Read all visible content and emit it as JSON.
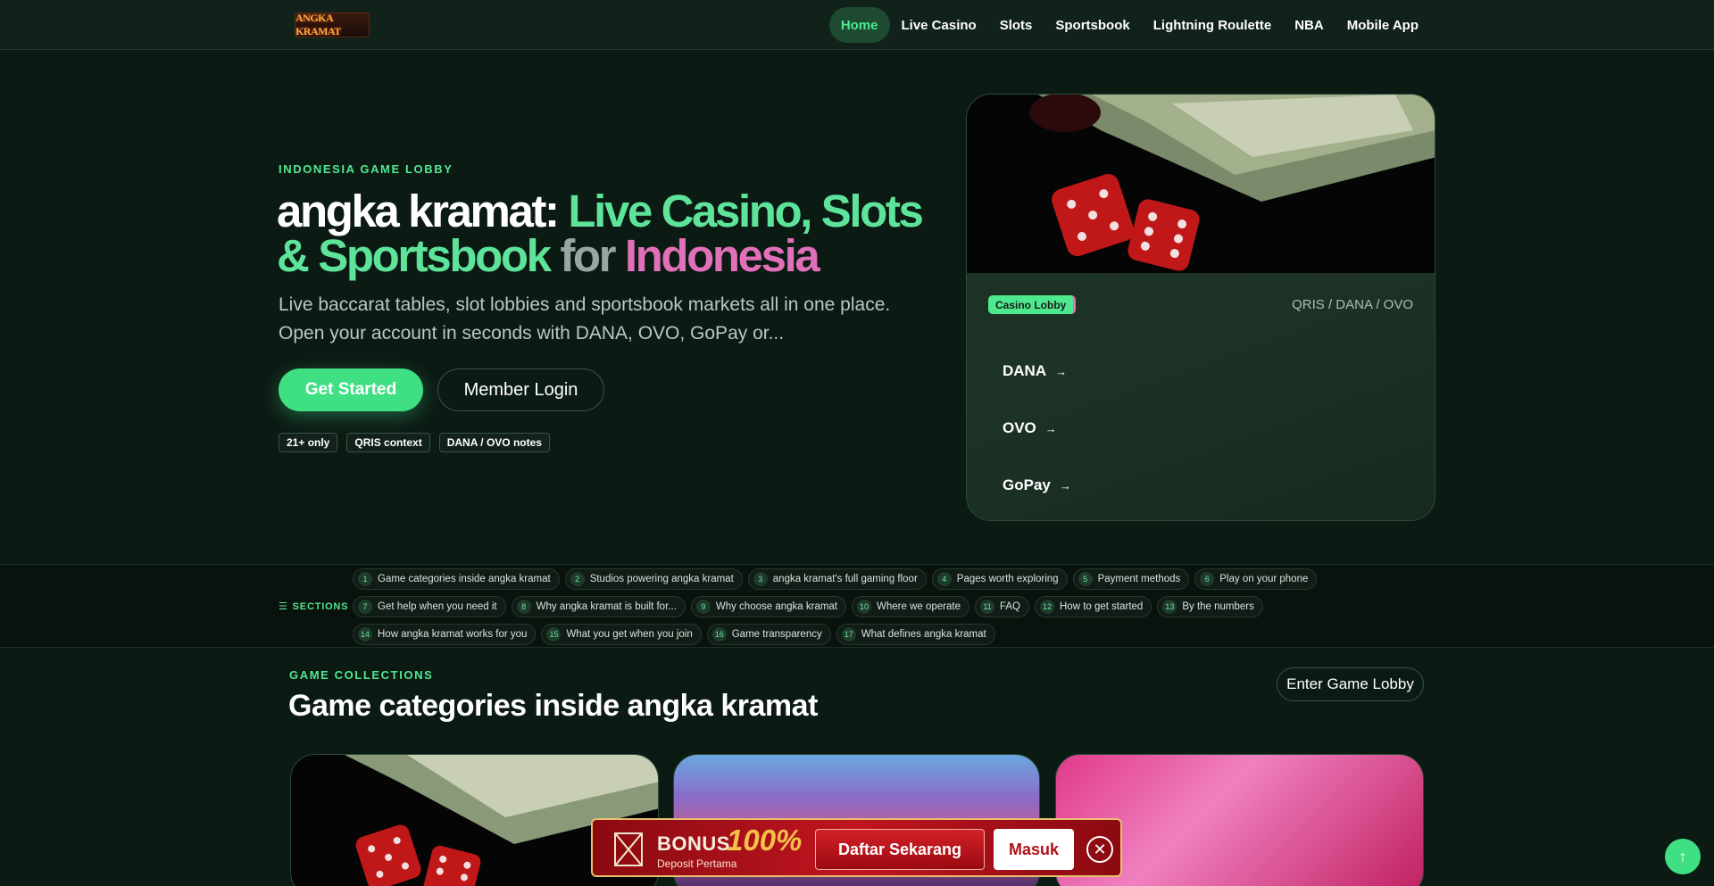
{
  "brand": {
    "logo_text": "ANGKA KRAMAT"
  },
  "nav": {
    "items": [
      {
        "label": "Home",
        "active": true
      },
      {
        "label": "Live Casino"
      },
      {
        "label": "Slots"
      },
      {
        "label": "Sportsbook"
      },
      {
        "label": "Lightning Roulette"
      },
      {
        "label": "NBA"
      },
      {
        "label": "Mobile App"
      }
    ]
  },
  "hero": {
    "eyebrow": "INDONESIA GAME LOBBY",
    "title_part1": "angka kramat: ",
    "title_part2": "Live Casino, Slots & Sportsbook",
    "title_part3": " for ",
    "title_part4": "Indonesia",
    "subtitle": "Live baccarat tables, slot lobbies and sportsbook markets all in one place. Open your account in seconds with DANA, OVO, GoPay or...",
    "primary_button": "Get Started",
    "secondary_button": "Member Login",
    "chips": [
      "21+ only",
      "QRIS context",
      "DANA / OVO notes"
    ]
  },
  "card": {
    "badge": "Casino Lobby",
    "payment_note": "QRIS / DANA / OVO",
    "payments": [
      "DANA",
      "OVO",
      "GoPay"
    ]
  },
  "sections": {
    "label": "SECTIONS",
    "items": [
      "Game categories inside angka kramat",
      "Studios powering angka kramat",
      "angka kramat's full gaming floor",
      "Pages worth exploring",
      "Payment methods",
      "Play on your phone",
      "Get help when you need it",
      "Why angka kramat is built for...",
      "Why choose angka kramat",
      "Where we operate",
      "FAQ",
      "How to get started",
      "By the numbers",
      "How angka kramat works for you",
      "What you get when you join",
      "Game transparency",
      "What defines angka kramat"
    ]
  },
  "collections": {
    "eyebrow": "GAME COLLECTIONS",
    "title": "Game categories inside angka kramat",
    "button": "Enter Game Lobby"
  },
  "bonus": {
    "word": "BONUS",
    "percent": "100%",
    "sub": "Deposit Pertama",
    "daftar": "Daftar Sekarang",
    "masuk": "Masuk"
  },
  "colors": {
    "accent": "#4ee98f",
    "bg": "#0c1a14",
    "pink": "#e070b8",
    "bonus_red": "#c01520"
  }
}
